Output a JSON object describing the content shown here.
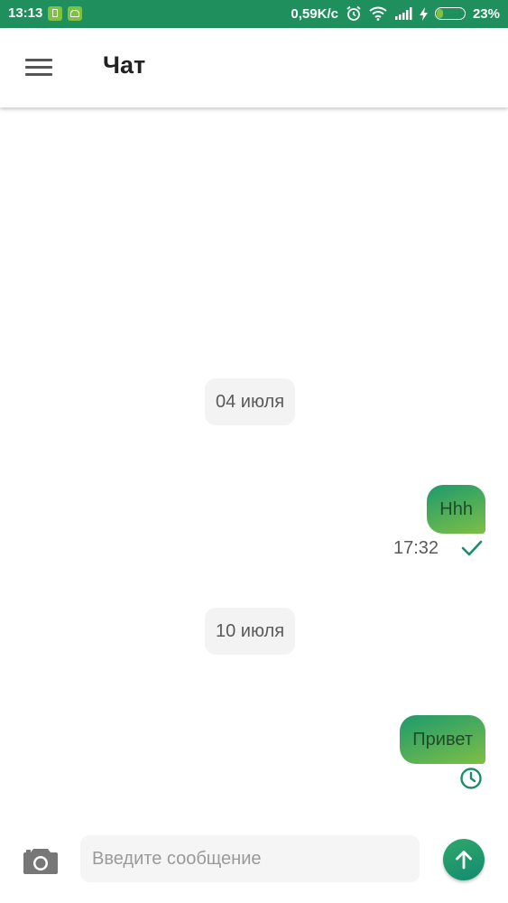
{
  "status_bar": {
    "time": "13:13",
    "network_speed": "0,59K/c",
    "battery_percent": "23%",
    "battery_level": 0.23,
    "icons": [
      "sim-icon",
      "android-icon",
      "alarm-icon",
      "wifi-icon",
      "signal-icon",
      "charging-icon",
      "battery-icon"
    ]
  },
  "app_bar": {
    "title": "Чат",
    "menu_icon": "hamburger-menu-icon"
  },
  "chat": {
    "groups": [
      {
        "date": "04 июля",
        "message": {
          "text": "Hhh",
          "time": "17:32",
          "status": "sent-checkmark"
        }
      },
      {
        "date": "10 июля",
        "message": {
          "text": "Привет",
          "time": "",
          "status": "pending-clock"
        }
      }
    ]
  },
  "composer": {
    "placeholder": "Введите сообщение",
    "value": "",
    "camera_icon": "camera-icon",
    "send_icon": "arrow-up-icon"
  },
  "colors": {
    "status_bar": "#1f8f5d",
    "accent": "#1a8f66",
    "bubble_start": "#1e9a6e",
    "bubble_end": "#7dbf45"
  }
}
